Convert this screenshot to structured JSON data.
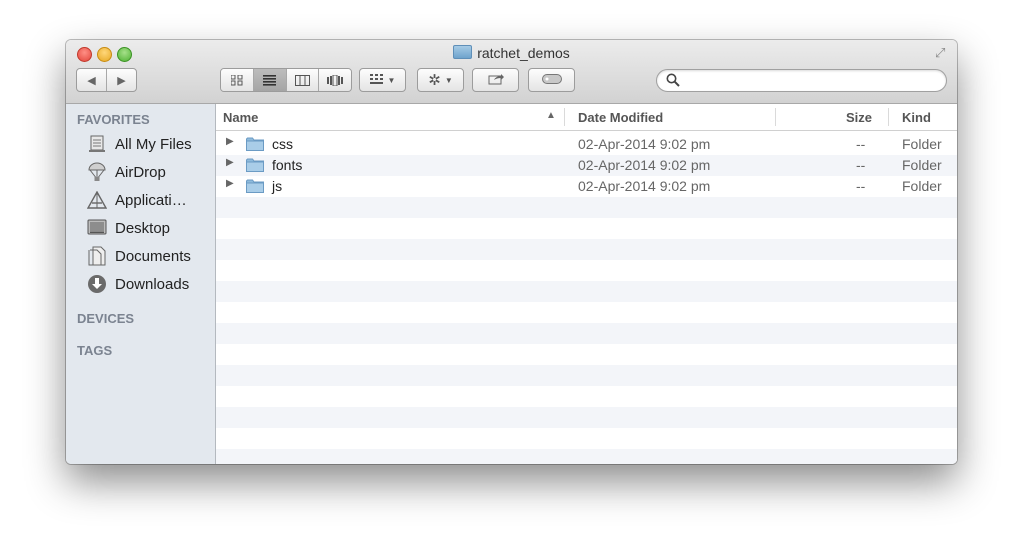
{
  "window": {
    "title": "ratchet_demos"
  },
  "toolbar": {
    "back_icon": "back-arrow-icon",
    "forward_icon": "forward-arrow-icon",
    "views": [
      "icon-view-icon",
      "list-view-icon",
      "column-view-icon",
      "coverflow-view-icon"
    ],
    "active_view": "list-view-icon",
    "arrange_icon": "arrange-grid-icon",
    "action_icon": "gear-icon",
    "share_icon": "share-icon",
    "tag_icon": "tag-icon"
  },
  "search": {
    "value": "",
    "placeholder": ""
  },
  "sidebar": {
    "favorites_heading": "FAVORITES",
    "favorites": [
      {
        "label": "All My Files",
        "icon": "all-files-icon"
      },
      {
        "label": "AirDrop",
        "icon": "airdrop-icon"
      },
      {
        "label": "Applicati…",
        "icon": "applications-icon"
      },
      {
        "label": "Desktop",
        "icon": "desktop-icon"
      },
      {
        "label": "Documents",
        "icon": "documents-icon"
      },
      {
        "label": "Downloads",
        "icon": "downloads-icon"
      }
    ],
    "devices_heading": "DEVICES",
    "tags_heading": "TAGS"
  },
  "columns": {
    "name": "Name",
    "date_modified": "Date Modified",
    "size": "Size",
    "kind": "Kind"
  },
  "files": [
    {
      "name": "css",
      "date": "02-Apr-2014 9:02 pm",
      "size": "--",
      "kind": "Folder"
    },
    {
      "name": "fonts",
      "date": "02-Apr-2014 9:02 pm",
      "size": "--",
      "kind": "Folder"
    },
    {
      "name": "js",
      "date": "02-Apr-2014 9:02 pm",
      "size": "--",
      "kind": "Folder"
    }
  ],
  "colors": {
    "sidebar_bg": "#e3e8ee",
    "folder_blue": "#8fbbdc",
    "row_alt": "#f3f5f9"
  }
}
